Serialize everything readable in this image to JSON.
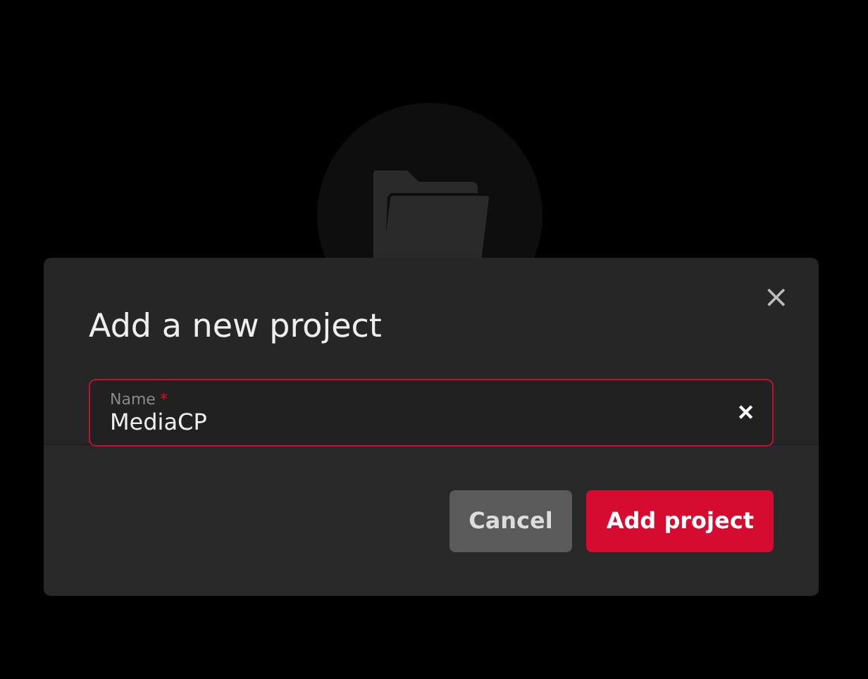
{
  "dialog": {
    "title": "Add a new project",
    "close": "×",
    "field": {
      "label": "Name",
      "required_mark": "*",
      "value": "MediaCP",
      "invalid": true,
      "clear": "✕"
    },
    "buttons": [
      {
        "label": "Cancel",
        "kind": "secondary"
      },
      {
        "label": "Add project",
        "kind": "primary"
      }
    ]
  }
}
